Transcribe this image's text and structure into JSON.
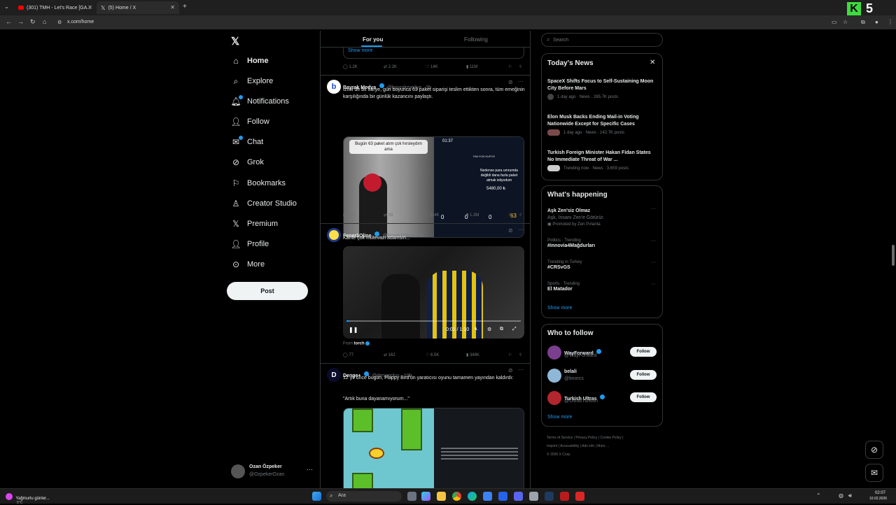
{
  "browser": {
    "tabs": [
      {
        "title": "(301) TMH - Let's Race [GA..."
      },
      {
        "title": "(5) Home / X"
      }
    ],
    "url": "x.com/home",
    "overlay_badge": "5"
  },
  "nav": {
    "items": [
      {
        "label": "Home",
        "icon": "home-icon"
      },
      {
        "label": "Explore",
        "icon": "search-icon"
      },
      {
        "label": "Notifications",
        "icon": "bell-icon"
      },
      {
        "label": "Follow",
        "icon": "person-add-icon"
      },
      {
        "label": "Chat",
        "icon": "mail-icon"
      },
      {
        "label": "Grok",
        "icon": "grok-icon"
      },
      {
        "label": "Bookmarks",
        "icon": "bookmark-icon"
      },
      {
        "label": "Creator Studio",
        "icon": "creator-icon"
      },
      {
        "label": "Premium",
        "icon": "x-icon"
      },
      {
        "label": "Profile",
        "icon": "profile-icon"
      },
      {
        "label": "More",
        "icon": "more-icon"
      }
    ],
    "post_label": "Post",
    "account": {
      "name": "Ozan Özpeker",
      "handle": "@OzpekerOzan"
    }
  },
  "feed": {
    "tab_for_you": "For you",
    "tab_following": "Following",
    "prev": {
      "show_more": "Show more",
      "replies": "1.2K",
      "reposts": "2.2K",
      "likes": "14K",
      "views": "11M"
    },
    "tweets": [
      {
        "name": "Bayrak Medya",
        "handle": "@bayrakmedya · 3h",
        "text": "İzmir'de bir kurye, gün boyunca 63 paket siparişi teslim ettikten sonra, tüm emeğinin karşılığında bir günlük kazancını paylaştı.",
        "img_caption": "Bugün 63 paket atım çok hırsleydım ama",
        "phone_time": "01:37",
        "phone_brand": "PAKYON KURYE",
        "phone_msg": "Nedense para umrumda değildi dana fazla paket atmak istiyodum",
        "phone_amount": "5480,00 ₺",
        "phone_stats": [
          "0",
          "0",
          "0",
          "63"
        ],
        "replies": "183",
        "reposts": "39",
        "likes": "2.4K",
        "views": "1.2M"
      },
      {
        "name": "Fener1Oline",
        "handle": "@Fener1Oline · 3h",
        "text": "Kante çok mütevazi adamsın...",
        "video_time": "0:01 / 1:10",
        "from": "From",
        "from_source": "torch",
        "replies": "77",
        "reposts": "162",
        "likes": "6.5K",
        "views": "348K"
      },
      {
        "name": "Denge+",
        "handle": "@dengeplus · 10h",
        "text": "12 yıl önce bugün, Flappy Bird'ün yaratıcısı oyunu tamamen yayından kaldırdı:",
        "quote": "\"Artık buna dayanamıyorum...\""
      }
    ]
  },
  "search": {
    "placeholder": "Search"
  },
  "news": {
    "title": "Today's News",
    "items": [
      {
        "title": "SpaceX Shifts Focus to Self-Sustaining Moon City Before Mars",
        "meta": "1 day ago · News · 285.7K posts"
      },
      {
        "title": "Elon Musk Backs Ending Mail-in Voting Nationwide Except for Specific Cases",
        "meta": "1 day ago · News · 142.7K posts"
      },
      {
        "title": "Turkish Foreign Minister Hakan Fidan States No Immediate Threat of War ...",
        "meta": "Trending now · News · 3,659 posts"
      }
    ]
  },
  "happening": {
    "title": "What's happening",
    "items": [
      {
        "context": "",
        "title": "Aşk Zen'siz Olmaz",
        "sub": "Aşk, İnsanı Zen'e Götürür.",
        "promo": "Promoted by Zen Pırlanta"
      },
      {
        "context": "Politics · Trending",
        "title": "#innovia4Mağdurları"
      },
      {
        "context": "Trending in Turkey",
        "title": "#CRSvGS"
      },
      {
        "context": "Sports · Trending",
        "title": "El Matador"
      }
    ],
    "show_more": "Show more"
  },
  "who_to_follow": {
    "title": "Who to follow",
    "users": [
      {
        "name": "WayForward",
        "handle": "@WayForward"
      },
      {
        "name": "belali",
        "handle": "@lmorcs"
      },
      {
        "name": "Turkish Ultras",
        "handle": "@UltrasTurkish"
      }
    ],
    "follow_label": "Follow",
    "show_more": "Show more"
  },
  "footer": {
    "links": [
      "Terms of Service",
      "Privacy Policy",
      "Cookie Policy",
      "Imprint",
      "Accessibility",
      "Ads info",
      "More ..."
    ],
    "copyright": "© 2026 X Corp."
  },
  "taskbar": {
    "weather": "Yağmurlu günler...",
    "temp": "5°C",
    "search": "Ara",
    "time": "02:07",
    "date": "10.02.2026"
  }
}
